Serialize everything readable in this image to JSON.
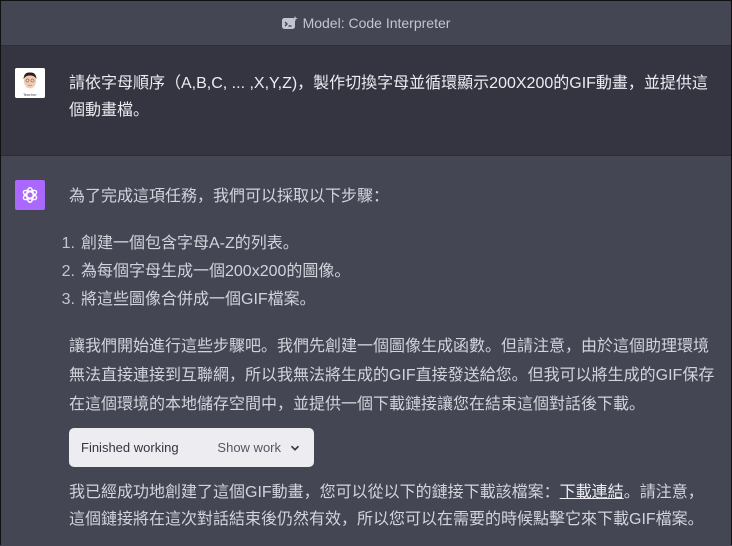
{
  "header": {
    "title": "Model: Code Interpreter",
    "icon": "code-interpreter-icon"
  },
  "user_message": {
    "avatar": "teacher-avatar",
    "avatar_caption": "Teacher",
    "text": "請依字母順序（A,B,C, ... ,X,Y,Z)，製作切換字母並循環顯示200X200的GIF動畫，並提供這個動畫檔。"
  },
  "assistant_message": {
    "avatar": "openai-logo-icon",
    "intro": "為了完成這項任務，我們可以採取以下步驟：",
    "steps": [
      {
        "num": "1.",
        "text": "創建一個包含字母A-Z的列表。"
      },
      {
        "num": "2.",
        "text": "為每個字母生成一個200x200的圖像。"
      },
      {
        "num": "3.",
        "text": "將這些圖像合併成一個GIF檔案。"
      }
    ],
    "paragraph": "讓我們開始進行這些步驟吧。我們先創建一個圖像生成函數。但請注意，由於這個助理環境無法直接連接到互聯網，所以我無法將生成的GIF直接發送給您。但我可以將生成的GIF保存在這個環境的本地儲存空間中，並提供一個下載鏈接讓您在結束這個對話後下載。",
    "work_status": {
      "label": "Finished working",
      "toggle_label": "Show work"
    },
    "final_before_link": "我已經成功地創建了這個GIF動畫，您可以從以下的鏈接下載該檔案：",
    "link_text": "下載連結",
    "final_after_link": "。請注意，這個鏈接將在這次對話結束後仍然有效，所以您可以在需要的時候點擊它來下載GIF檔案。"
  },
  "colors": {
    "user_bg": "#343541",
    "assistant_bg": "#444654",
    "gpt_avatar": "#ab68ff",
    "work_box_bg": "#ececf1"
  }
}
